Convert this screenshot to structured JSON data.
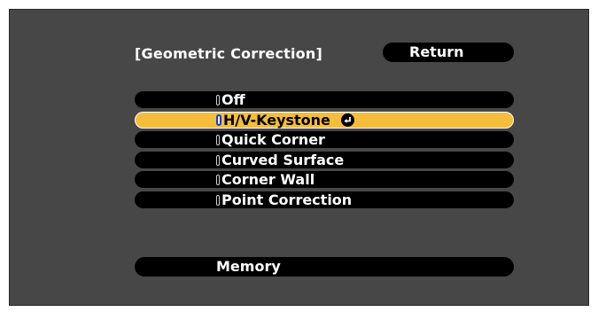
{
  "header": {
    "title": "[Geometric Correction]",
    "return_label": "Return"
  },
  "menu": {
    "items": [
      {
        "label": "Off",
        "selected": false
      },
      {
        "label": "H/V-Keystone",
        "selected": true
      },
      {
        "label": "Quick Corner",
        "selected": false
      },
      {
        "label": "Curved Surface",
        "selected": false
      },
      {
        "label": "Corner Wall",
        "selected": false
      },
      {
        "label": "Point Correction",
        "selected": false
      }
    ],
    "selected_icon": "enter-icon"
  },
  "memory": {
    "label": "Memory"
  },
  "colors": {
    "background": "#474747",
    "button": "#000000",
    "highlight": "#f4bd3c",
    "text": "#ffffff"
  }
}
